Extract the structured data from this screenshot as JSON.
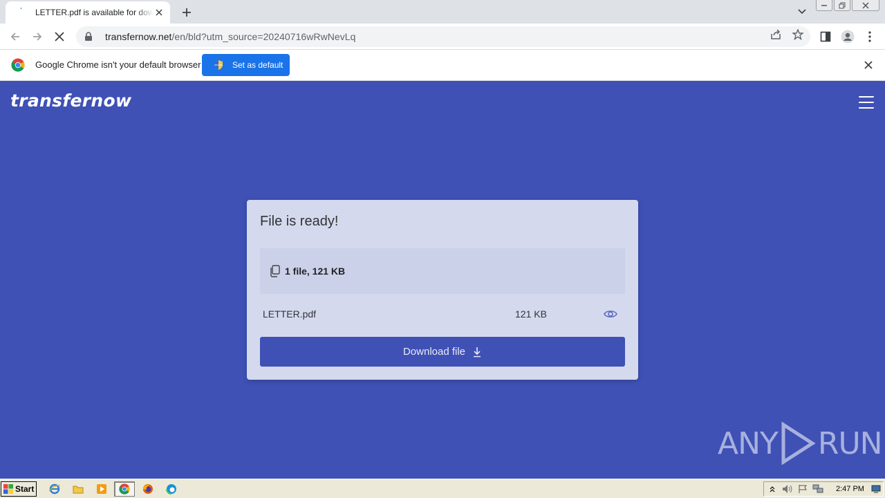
{
  "browser": {
    "tab": {
      "title": "LETTER.pdf is available for download"
    },
    "url": {
      "host": "transfernow.net",
      "path": "/en/bld?utm_source=20240716wRwNevLq"
    },
    "infobar": {
      "message": "Google Chrome isn't your default browser",
      "button_label": "Set as default"
    }
  },
  "page": {
    "brand": "transfernow",
    "card": {
      "title": "File is ready!",
      "summary": "1 file, 121 KB",
      "files": [
        {
          "name": "LETTER.pdf",
          "size": "121 KB"
        }
      ],
      "download_label": "Download file"
    },
    "watermark": {
      "left": "ANY",
      "right": "RUN"
    }
  },
  "taskbar": {
    "start_label": "Start",
    "clock": "2:47 PM"
  },
  "colors": {
    "page_bg": "#3f51b5",
    "card_bg": "#d4d9ee",
    "accent": "#1a73e8"
  }
}
